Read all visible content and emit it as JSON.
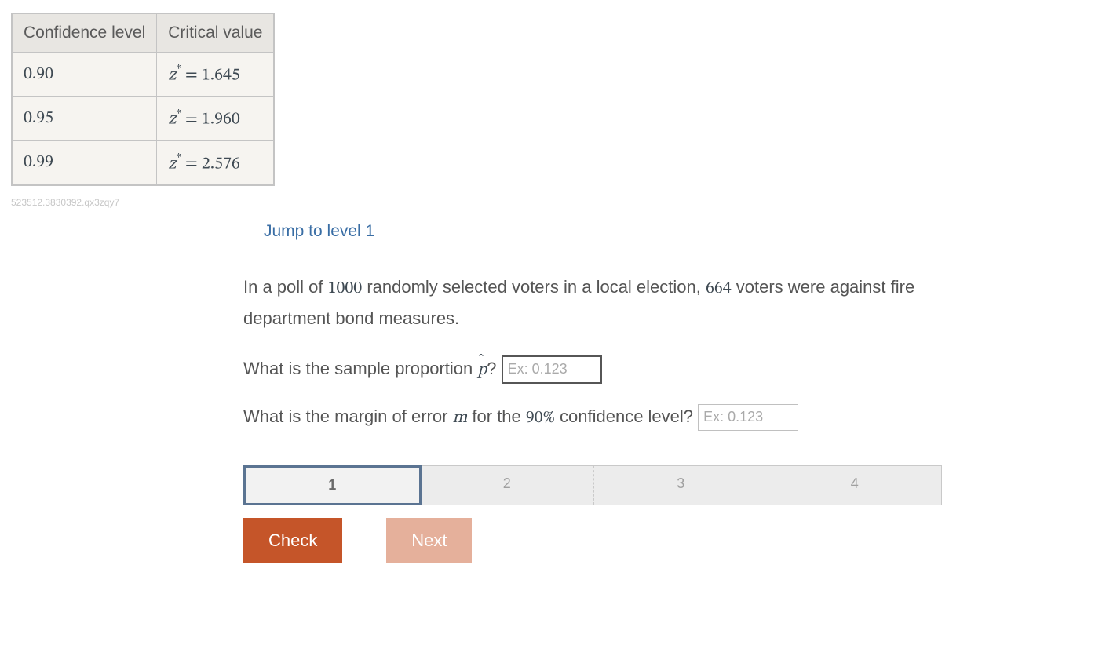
{
  "table": {
    "headers": [
      "Confidence level",
      "Critical value"
    ],
    "rows": [
      {
        "conf": "0.90",
        "crit": "z*  =  1.645"
      },
      {
        "conf": "0.95",
        "crit": "z*  =  1.960"
      },
      {
        "conf": "0.99",
        "crit": "z*  =  2.576"
      }
    ]
  },
  "hash": "523512.3830392.qx3zqy7",
  "jump_label": "Jump to level 1",
  "problem": {
    "pre1": "In a poll of ",
    "n": "1000",
    "mid1": " randomly selected voters in a local election, ",
    "k": "664",
    "post1": " voters were against fire department bond measures."
  },
  "q1": {
    "pre": "What is the sample proportion ",
    "sym": "p",
    "post": "? ",
    "placeholder": "Ex: 0.123"
  },
  "q2": {
    "pre": "What is the margin of error ",
    "sym": "m",
    "mid": " for the ",
    "pct": "90%",
    "post": " confidence level? ",
    "placeholder": "Ex: 0.123"
  },
  "steps": [
    "1",
    "2",
    "3",
    "4"
  ],
  "buttons": {
    "check": "Check",
    "next": "Next"
  }
}
